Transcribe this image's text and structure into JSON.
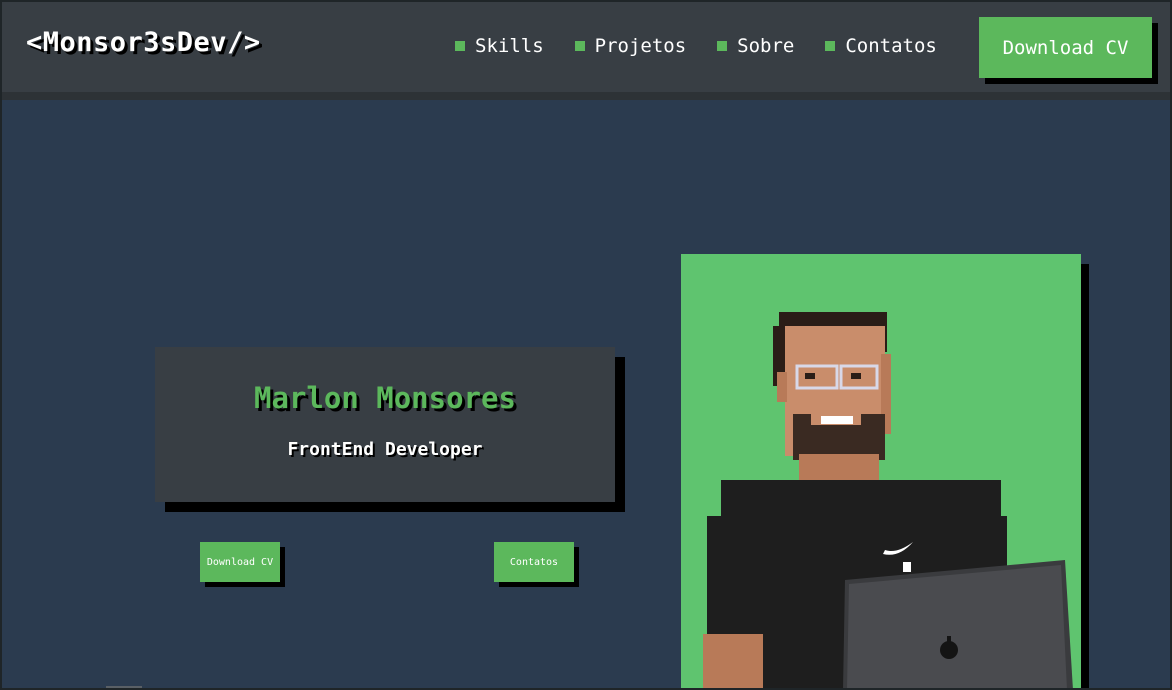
{
  "header": {
    "logo": "<Monsor3sDev/>",
    "nav": [
      {
        "label": "Skills"
      },
      {
        "label": "Projetos"
      },
      {
        "label": "Sobre"
      },
      {
        "label": "Contatos"
      }
    ],
    "download_cv_label": "Download CV"
  },
  "hero": {
    "name": "Marlon Monsores",
    "role": "FrontEnd Developer",
    "download_cv_label": "Download CV",
    "contacts_label": "Contatos"
  },
  "colors": {
    "accent": "#5cb85c",
    "background": "#2b3b4f",
    "header_bg": "#383e44",
    "photo_bg": "#5fc46f"
  },
  "icons": {
    "nav_bullet": "square-bullet-icon",
    "laptop_logo": "apple-logo-icon",
    "shirt_logo": "swoosh-icon"
  }
}
